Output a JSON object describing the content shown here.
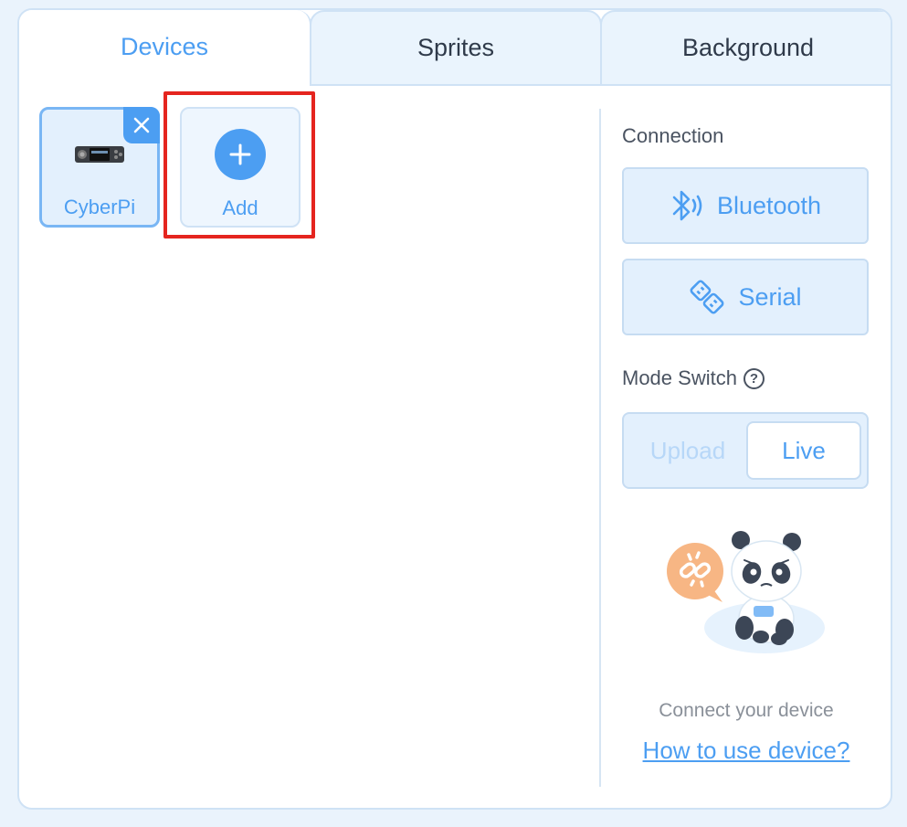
{
  "tabs": [
    {
      "label": "Devices",
      "active": true
    },
    {
      "label": "Sprites",
      "active": false
    },
    {
      "label": "Background",
      "active": false
    }
  ],
  "devices": {
    "items": [
      {
        "label": "CyberPi",
        "icon": "cyberpi-device-icon"
      }
    ],
    "add_label": "Add"
  },
  "connection": {
    "label": "Connection",
    "bluetooth_label": "Bluetooth",
    "serial_label": "Serial"
  },
  "mode_switch": {
    "label": "Mode Switch",
    "upload_label": "Upload",
    "live_label": "Live",
    "selected": "Live"
  },
  "status": {
    "connect_text": "Connect your device",
    "howto_link": "How to use device?"
  },
  "colors": {
    "accent": "#4c9ef2",
    "highlight": "#e5251f",
    "tab_bg": "#eaf4fd"
  }
}
